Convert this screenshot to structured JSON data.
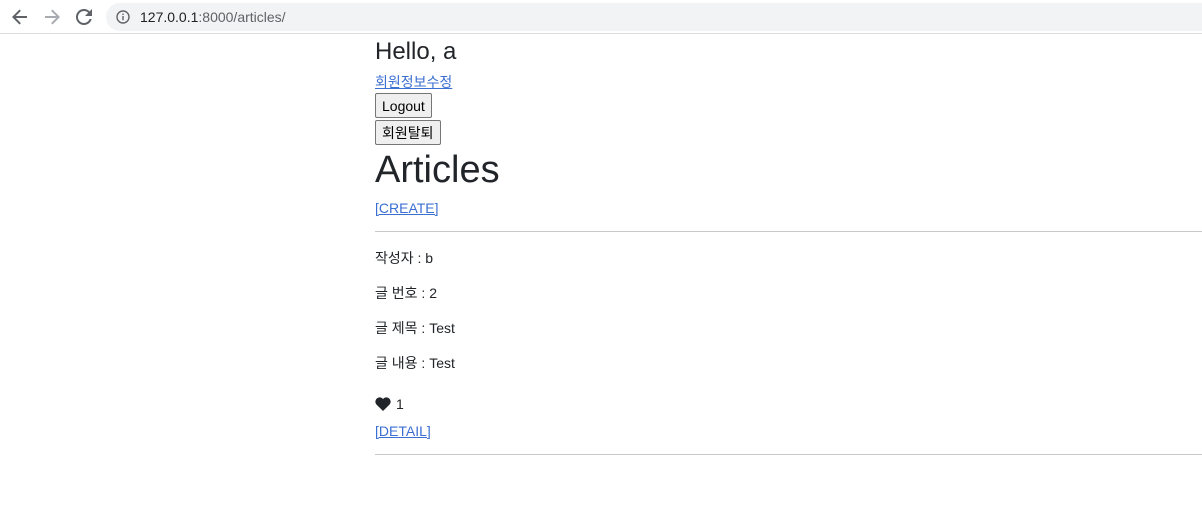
{
  "browser": {
    "url_host": "127.0.0.1",
    "url_path": ":8000/articles/"
  },
  "header": {
    "greeting": "Hello, a",
    "edit_profile_link": "회원정보수정",
    "logout_button": "Logout",
    "delete_account_button": "회원탈퇴"
  },
  "main": {
    "title": "Articles",
    "create_link": "[CREATE]",
    "articles": [
      {
        "author_label": "작성자 : b",
        "number_label": "글 번호 : 2",
        "title_label": "글 제목 : Test",
        "content_label": "글 내용 : Test",
        "like_count": "1",
        "like_icon": "heart-icon",
        "detail_link": "[DETAIL]"
      }
    ]
  }
}
